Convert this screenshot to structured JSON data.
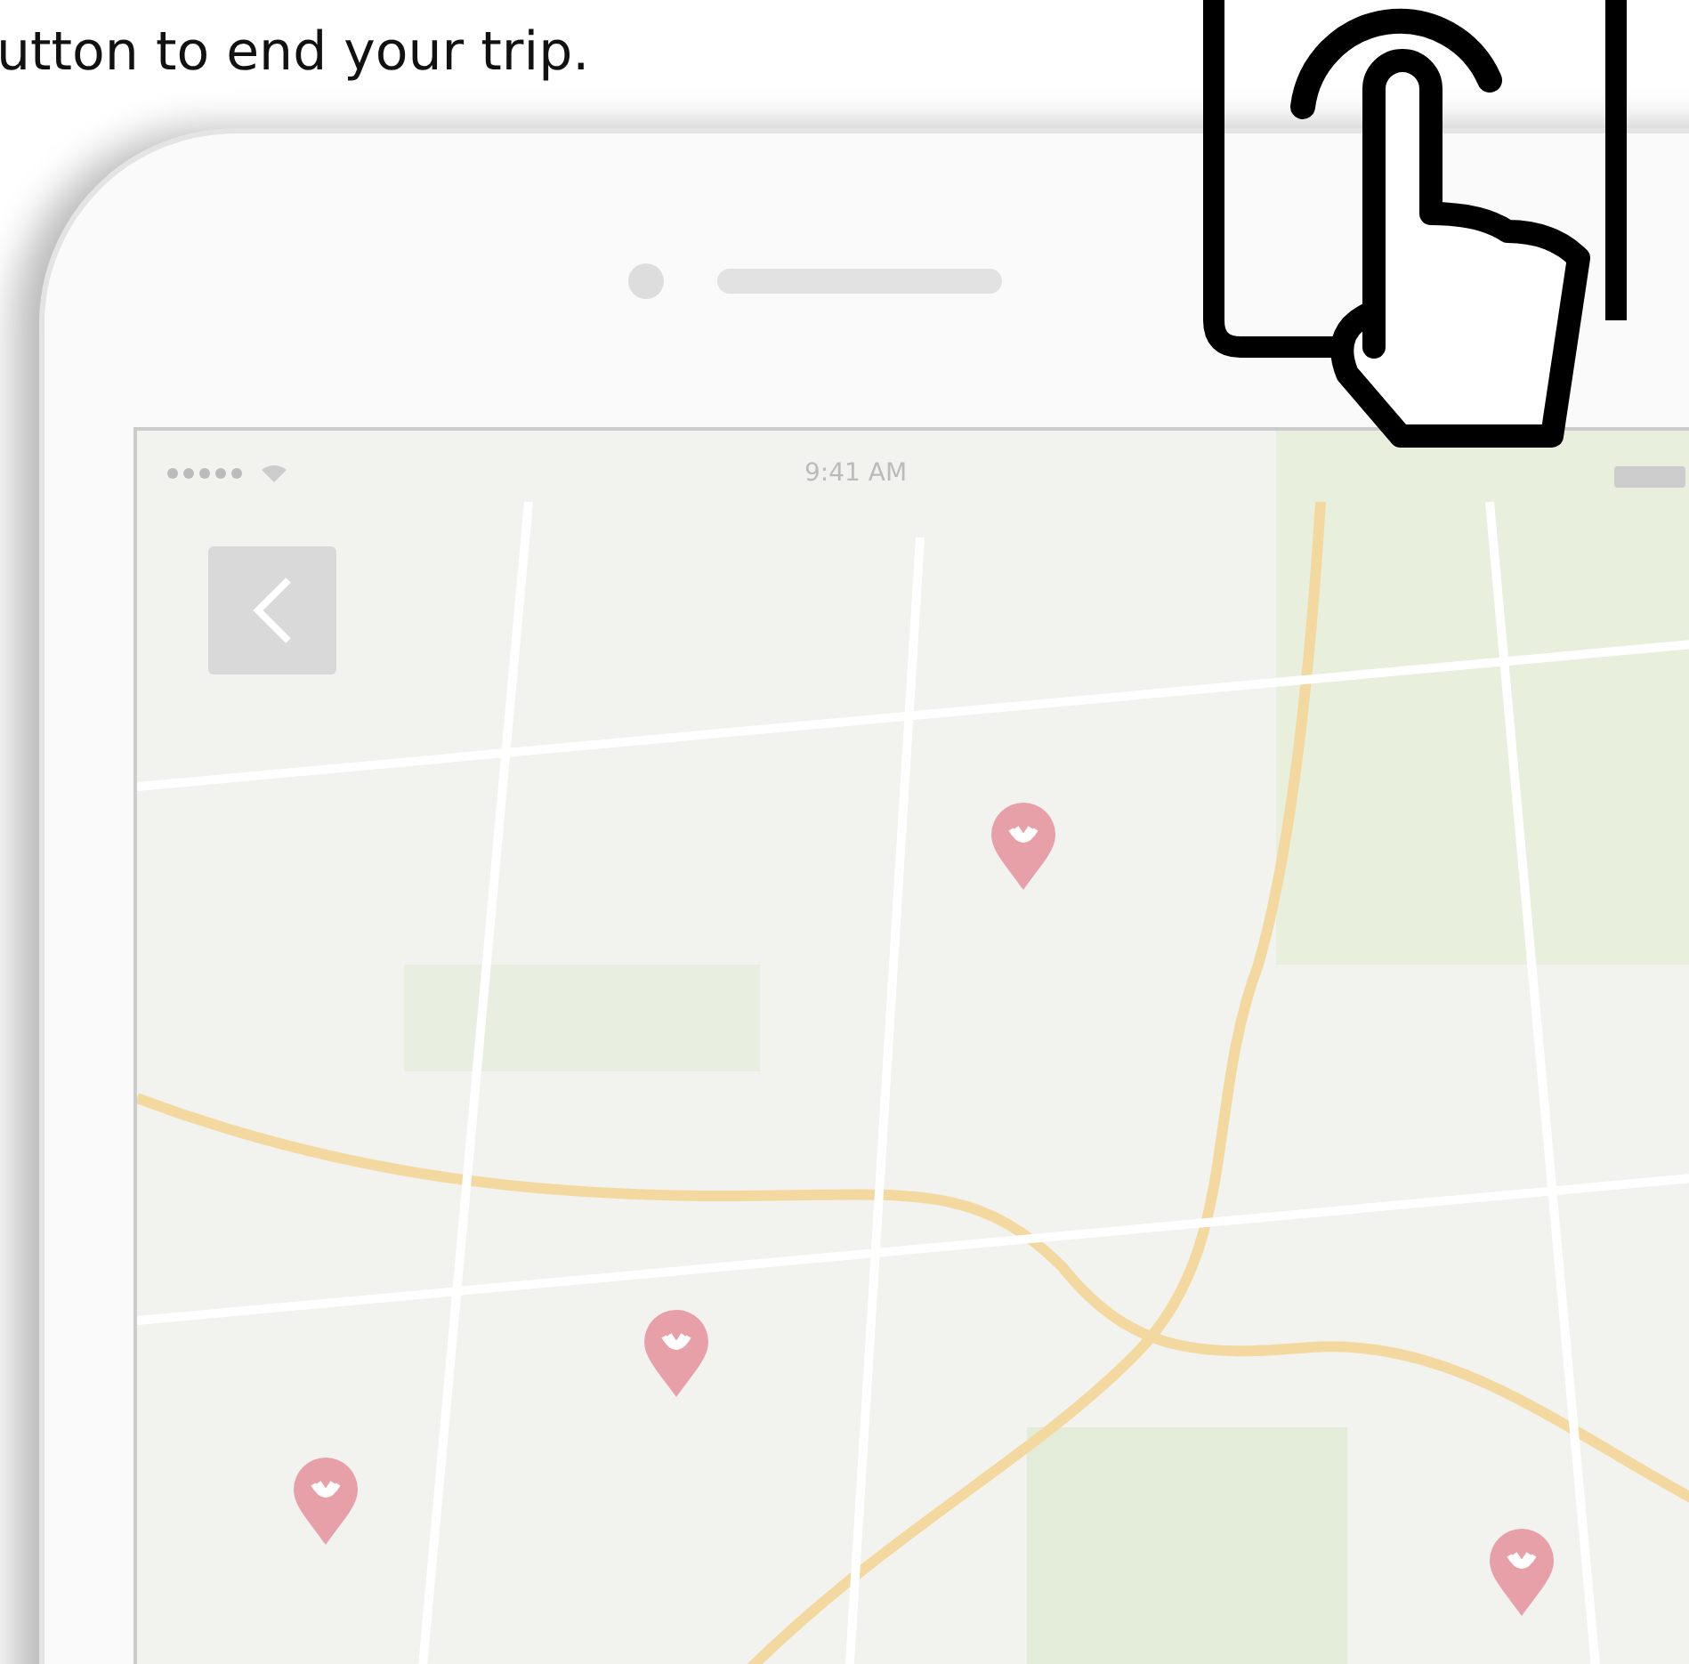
{
  "caption": "utton to end your trip.",
  "status_bar": {
    "time": "9:41 AM"
  }
}
